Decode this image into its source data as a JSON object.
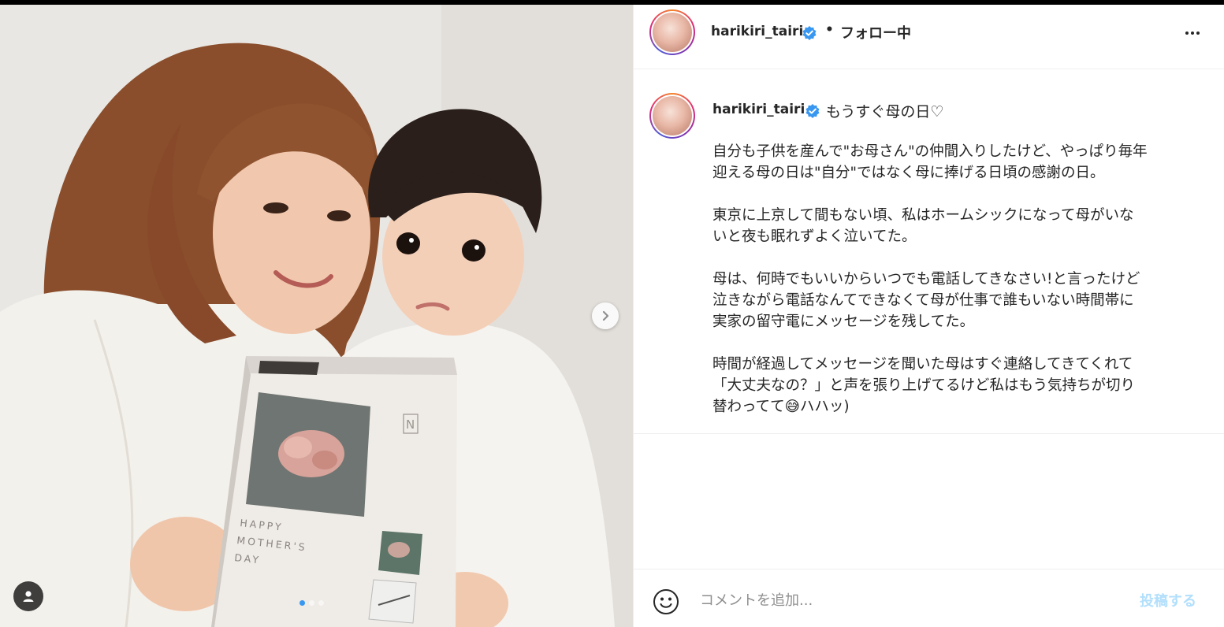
{
  "post": {
    "photo_card": {
      "brand_mark": "N",
      "card_text_lines": [
        "HAPPY",
        "MOTHER'S",
        "DAY"
      ]
    },
    "carousel": {
      "total": 3,
      "active_index": 0
    }
  },
  "header": {
    "username": "harikiri_tairi",
    "separator": "•",
    "follow_status": "フォロー中"
  },
  "caption": {
    "username": "harikiri_tairi",
    "lead": "もうすぐ母の日♡",
    "paragraphs": [
      "自分も子供を産んで\"お母さん\"の仲間入りしたけど、やっぱり毎年\n迎える母の日は\"自分\"ではなく母に捧げる日頃の感謝の日。",
      "東京に上京して間もない頃、私はホームシックになって母がいな\nいと夜も眠れずよく泣いてた。",
      "母は、何時でもいいからいつでも電話してきなさい!と言ったけど\n泣きながら電話なんてできなくて母が仕事で誰もいない時間帯に\n実家の留守電にメッセージを残してた。",
      "時間が経過してメッセージを聞いた母はすぐ連絡してきてくれて\n「大丈夫なの？」と声を張り上げてるけど私はもう気持ちが切り\n替わってて😅ハハッ)"
    ]
  },
  "comment": {
    "placeholder": "コメントを追加...",
    "post_label": "投稿する"
  },
  "colors": {
    "verified_blue": "#3897f0",
    "post_button_disabled": "#b2dffc",
    "text": "#262626",
    "muted": "#8e8e8e"
  },
  "icons": {
    "verified": "verified-badge-icon",
    "more": "more-options-icon",
    "next": "chevron-right-icon",
    "tag": "user-tag-icon",
    "emoji": "emoji-smile-icon"
  }
}
